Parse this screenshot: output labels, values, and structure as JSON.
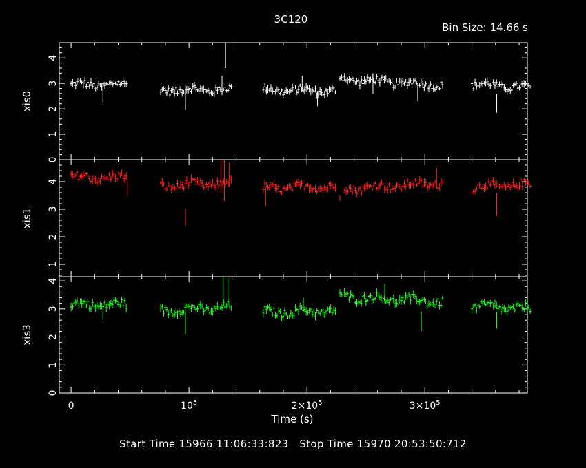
{
  "chart_data": {
    "type": "scatter",
    "title": "3C120",
    "bin_size_label": "Bin Size: 14.66 s",
    "xlabel": "Time (s)",
    "xlim": [
      -10000,
      387000
    ],
    "xticks": [
      {
        "value": 0,
        "label": "0"
      },
      {
        "value": 100000,
        "label": "10",
        "sup": "5"
      },
      {
        "value": 200000,
        "label": "2×10",
        "sup": "5"
      },
      {
        "value": 300000,
        "label": "3×10",
        "sup": "5"
      }
    ],
    "panels": [
      {
        "name": "xis0",
        "ylabel": "xis0",
        "color": "#ffffff",
        "ylim": [
          0,
          4.6
        ],
        "yticks": [
          0,
          1,
          2,
          3,
          4
        ],
        "segments": [
          {
            "start": 0,
            "end": 48000,
            "level": 2.95,
            "trend": 0.0
          },
          {
            "start": 76000,
            "end": 136000,
            "level": 2.75,
            "trend": 0.0
          },
          {
            "start": 163000,
            "end": 225000,
            "level": 2.72,
            "trend": -0.05
          },
          {
            "start": 228000,
            "end": 316000,
            "level": 3.05,
            "trend": -0.25
          },
          {
            "start": 340000,
            "end": 390000,
            "level": 2.9,
            "trend": -0.15
          }
        ],
        "spikes": [
          {
            "x": 27000,
            "low": 2.25,
            "high": 3.0
          },
          {
            "x": 97000,
            "low": 1.95,
            "high": 2.8
          },
          {
            "x": 128000,
            "low": 2.6,
            "high": 3.3
          },
          {
            "x": 131000,
            "low": 3.6,
            "high": 4.6
          },
          {
            "x": 196000,
            "low": 2.7,
            "high": 3.3
          },
          {
            "x": 209000,
            "low": 2.1,
            "high": 2.7
          },
          {
            "x": 256000,
            "low": 2.6,
            "high": 3.4
          },
          {
            "x": 294000,
            "low": 2.3,
            "high": 3.0
          },
          {
            "x": 361000,
            "low": 1.85,
            "high": 2.6
          }
        ]
      },
      {
        "name": "xis1",
        "ylabel": "xis1",
        "color": "#ff2020",
        "ylim": [
          0.55,
          4.8
        ],
        "yticks": [
          1,
          2,
          3,
          4
        ],
        "segments": [
          {
            "start": 0,
            "end": 48000,
            "level": 4.15,
            "trend": 0.0
          },
          {
            "start": 76000,
            "end": 136000,
            "level": 3.9,
            "trend": 0.1
          },
          {
            "start": 163000,
            "end": 225000,
            "level": 3.8,
            "trend": 0.1
          },
          {
            "start": 232000,
            "end": 316000,
            "level": 3.85,
            "trend": 0.2
          },
          {
            "start": 340000,
            "end": 390000,
            "level": 3.85,
            "trend": 0.1
          }
        ],
        "spikes": [
          {
            "x": 48000,
            "low": 3.5,
            "high": 4.0
          },
          {
            "x": 97000,
            "low": 2.4,
            "high": 3.0
          },
          {
            "x": 127000,
            "low": 3.6,
            "high": 4.8
          },
          {
            "x": 130000,
            "low": 3.3,
            "high": 4.8
          },
          {
            "x": 134000,
            "low": 3.8,
            "high": 4.7
          },
          {
            "x": 165000,
            "low": 3.1,
            "high": 3.8
          },
          {
            "x": 228000,
            "low": 3.3,
            "high": 3.5
          },
          {
            "x": 310000,
            "low": 3.9,
            "high": 4.5
          },
          {
            "x": 361000,
            "low": 2.75,
            "high": 3.6
          }
        ]
      },
      {
        "name": "xis3",
        "ylabel": "xis3",
        "color": "#20ff20",
        "ylim": [
          0,
          4.15
        ],
        "yticks": [
          0,
          1,
          2,
          3,
          4
        ],
        "segments": [
          {
            "start": 0,
            "end": 48000,
            "level": 3.15,
            "trend": 0.0
          },
          {
            "start": 76000,
            "end": 136000,
            "level": 3.0,
            "trend": 0.1
          },
          {
            "start": 163000,
            "end": 225000,
            "level": 2.9,
            "trend": 0.05
          },
          {
            "start": 228000,
            "end": 316000,
            "level": 3.35,
            "trend": -0.2
          },
          {
            "start": 340000,
            "end": 390000,
            "level": 3.05,
            "trend": -0.1
          }
        ],
        "spikes": [
          {
            "x": 27000,
            "low": 2.6,
            "high": 3.2
          },
          {
            "x": 97000,
            "low": 2.1,
            "high": 2.9
          },
          {
            "x": 129000,
            "low": 3.0,
            "high": 4.15
          },
          {
            "x": 133000,
            "low": 3.2,
            "high": 4.15
          },
          {
            "x": 197000,
            "low": 2.9,
            "high": 3.4
          },
          {
            "x": 266000,
            "low": 3.2,
            "high": 3.9
          },
          {
            "x": 297000,
            "low": 2.2,
            "high": 2.9
          },
          {
            "x": 361000,
            "low": 2.3,
            "high": 2.9
          }
        ]
      }
    ]
  },
  "footer": {
    "start_time": "Start Time 15966 11:06:33:823",
    "stop_time": "Stop Time 15970 20:53:50:712"
  }
}
